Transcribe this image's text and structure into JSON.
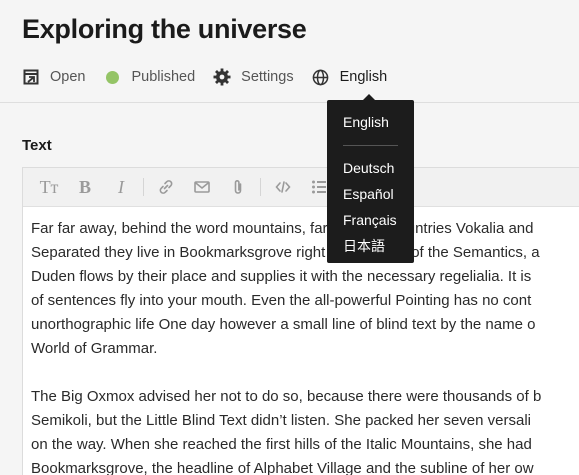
{
  "page": {
    "title": "Exploring the universe"
  },
  "meta": {
    "open_label": "Open",
    "status_label": "Published",
    "status_color": "#94c466",
    "settings_label": "Settings",
    "language_label": "English"
  },
  "field": {
    "label": "Text"
  },
  "toolbar": {
    "text_style_glyph": "Tт",
    "bold_glyph": "B",
    "italic_glyph": "I",
    "icons": [
      "text-style-icon",
      "bold-icon",
      "italic-icon",
      "link-icon",
      "email-icon",
      "attachment-icon",
      "code-icon",
      "bullet-list-icon",
      "ordered-list-icon"
    ]
  },
  "editor": {
    "paragraphs": [
      [
        "Far far away, behind the word mountains, far from the countries Vokalia and",
        "Separated they live in Bookmarksgrove right at the coast of the Semantics, a",
        "Duden flows by their place and supplies it with the necessary regelialia. It is",
        "of sentences fly into your mouth. Even the all-powerful Pointing has no cont",
        "unorthographic life One day however a small line of blind text by the name o",
        "World of Grammar."
      ],
      [
        "The Big Oxmox advised her not to do so, because there were thousands of b",
        "Semikoli, but the Little Blind Text didn’t listen. She packed her seven versali",
        "on the way. When she reached the first hills of the Italic Mountains, she had",
        "Bookmarksgrove, the headline of Alphabet Village and the subline of her ow"
      ]
    ]
  },
  "language_menu": {
    "current": "English",
    "options": [
      "Deutsch",
      "Español",
      "Français",
      "日本語"
    ]
  }
}
